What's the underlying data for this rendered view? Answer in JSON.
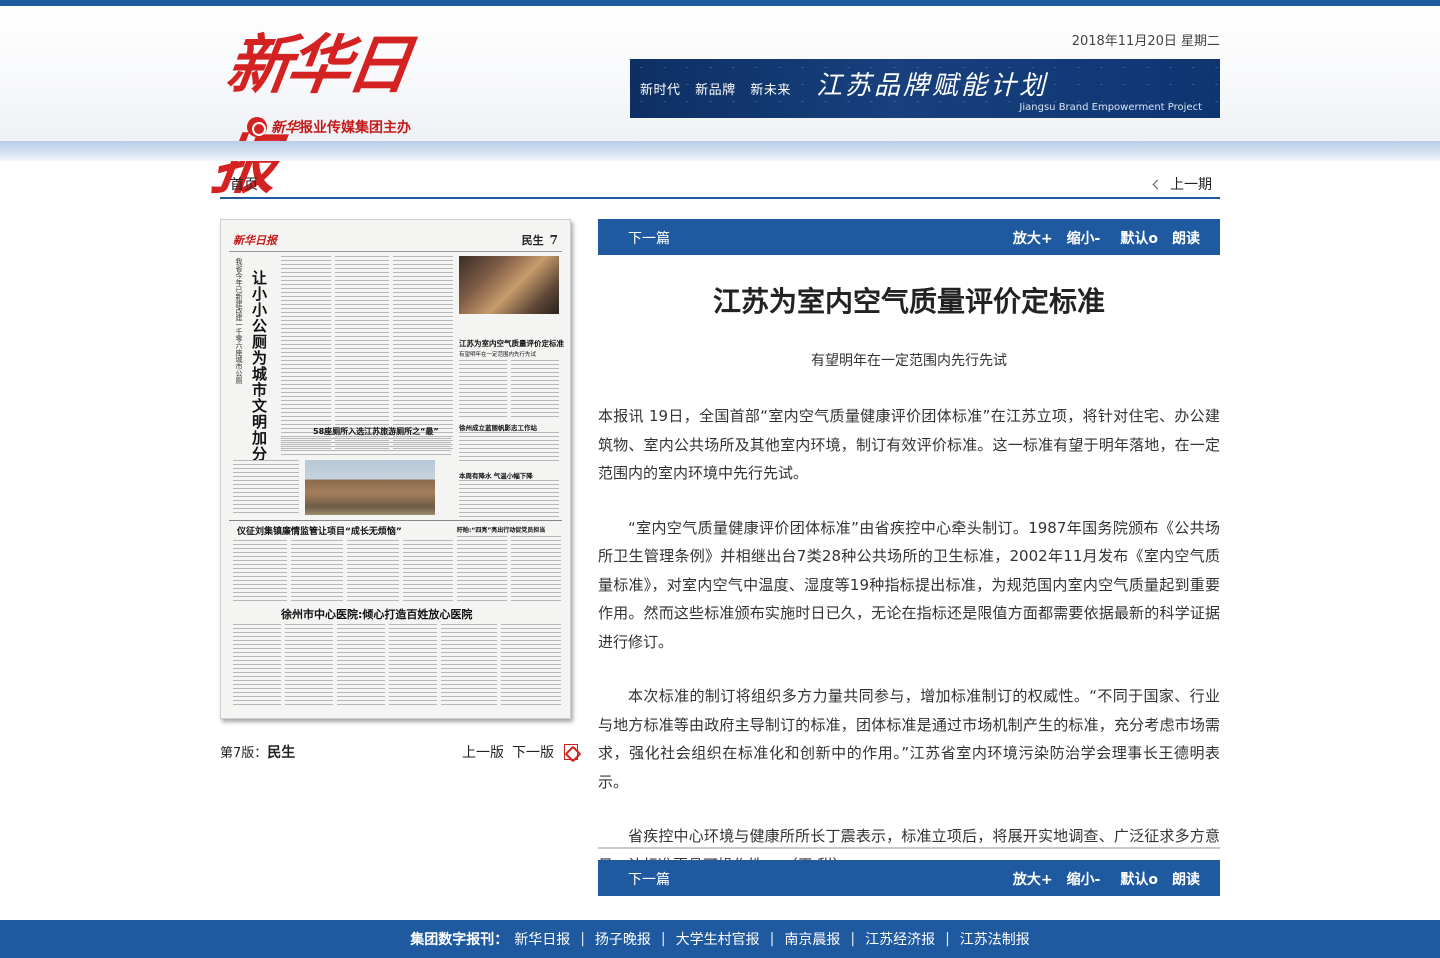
{
  "header": {
    "logo_text": "新华日报",
    "sub_logo_brand": "新华",
    "sub_logo_text": "报业传媒集团主办",
    "date": "2018年11月20日  星期二",
    "banner": {
      "slogans": [
        "新时代",
        "新品牌",
        "新未来"
      ],
      "title": "江苏品牌赋能计划",
      "english": "Jiangsu Brand Empowerment Project"
    }
  },
  "nav": {
    "home": "首页",
    "prev_issue": "上一期"
  },
  "paper": {
    "masthead": "新华日报",
    "section": "民生",
    "page_no": "7",
    "headline_vertical": "让小小公厕为城市文明加分",
    "subline_vertical": "我省今年已新建改建一千零六座城市公厕",
    "h1": "58座厕所入选江苏旅游厕所之“最”",
    "h2": "江苏为室内空气质量评价定标准",
    "h2_sub": "有望明年在一定范围内先行先试",
    "h3": "徐州成立蓝丽帆影志工作站",
    "h4": "本周有降水 气温小幅下降",
    "h5": "仪征刘集镇廉情监管让项目“成长无烦恼”",
    "h6": "盱眙:“四亮”亮出行动促党员担当",
    "h7": "徐州市中心医院:倾心打造百姓放心医院",
    "caption_prefix": "第7版：",
    "caption_section": "民生",
    "prev_page": "上一版",
    "next_page": "下一版"
  },
  "toolbar": {
    "next_article": "下一篇",
    "zoom_in": "放大+",
    "zoom_out": "缩小-",
    "default": "默认o",
    "read_aloud": "朗读"
  },
  "article": {
    "title": "江苏为室内空气质量评价定标准",
    "subtitle": "有望明年在一定范围内先行先试",
    "paragraphs": [
      "本报讯 19日，全国首部“室内空气质量健康评价团体标准”在江苏立项，将针对住宅、办公建筑物、室内公共场所及其他室内环境，制订有效评价标准。这一标准有望于明年落地，在一定范围内的室内环境中先行先试。",
      "“室内空气质量健康评价团体标准”由省疾控中心牵头制订。1987年国务院颁布《公共场所卫生管理条例》并相继出台7类28种公共场所的卫生标准，2002年11月发布《室内空气质量标准》，对室内空气中温度、湿度等19种指标提出标准，为规范国内室内空气质量起到重要作用。然而这些标准颁布实施时日已久，无论在指标还是限值方面都需要依据最新的科学证据进行修订。",
      "本次标准的制订将组织多方力量共同参与，增加标准制订的权威性。“不同于国家、行业与地方标准等由政府主导制订的标准，团体标准是通过市场机制产生的标准，充分考虑市场需求，强化社会组织在标准化和创新中的作用。”江苏省室内环境污染防治学会理事长王德明表示。",
      "省疾控中心环境与健康所所长丁震表示，标准立项后，将展开实地调查、广泛征求多方意见，让标准更具可操作性。 （王 甜）"
    ]
  },
  "footer": {
    "label": "集团数字报刊：",
    "links": [
      "新华日报",
      "扬子晚报",
      "大学生村官报",
      "南京晨报",
      "江苏经济报",
      "江苏法制报"
    ]
  },
  "colors": {
    "brand_blue": "#1f5aa0",
    "logo_red": "#d42222"
  }
}
